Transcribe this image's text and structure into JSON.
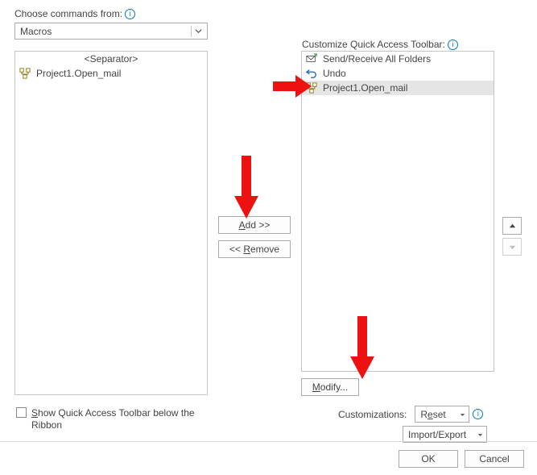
{
  "labels": {
    "choose_from": "Choose commands from:",
    "customize_qat": "Customize Quick Access Toolbar:",
    "customizations": "Customizations:",
    "show_qat_below": "Show Quick Access Toolbar below the Ribbon"
  },
  "dropdowns": {
    "source": "Macros",
    "reset": "Reset",
    "import_export": "Import/Export"
  },
  "buttons": {
    "add": "Add >>",
    "remove": "<< Remove",
    "modify": "Modify...",
    "ok": "OK",
    "cancel": "Cancel"
  },
  "left_list": {
    "separator": "<Separator>",
    "items": [
      {
        "label": "Project1.Open_mail"
      }
    ]
  },
  "right_list": {
    "items": [
      {
        "label": "Send/Receive All Folders",
        "icon": "sendreceive"
      },
      {
        "label": "Undo",
        "icon": "undo"
      },
      {
        "label": "Project1.Open_mail",
        "icon": "macro",
        "selected": true
      }
    ]
  }
}
